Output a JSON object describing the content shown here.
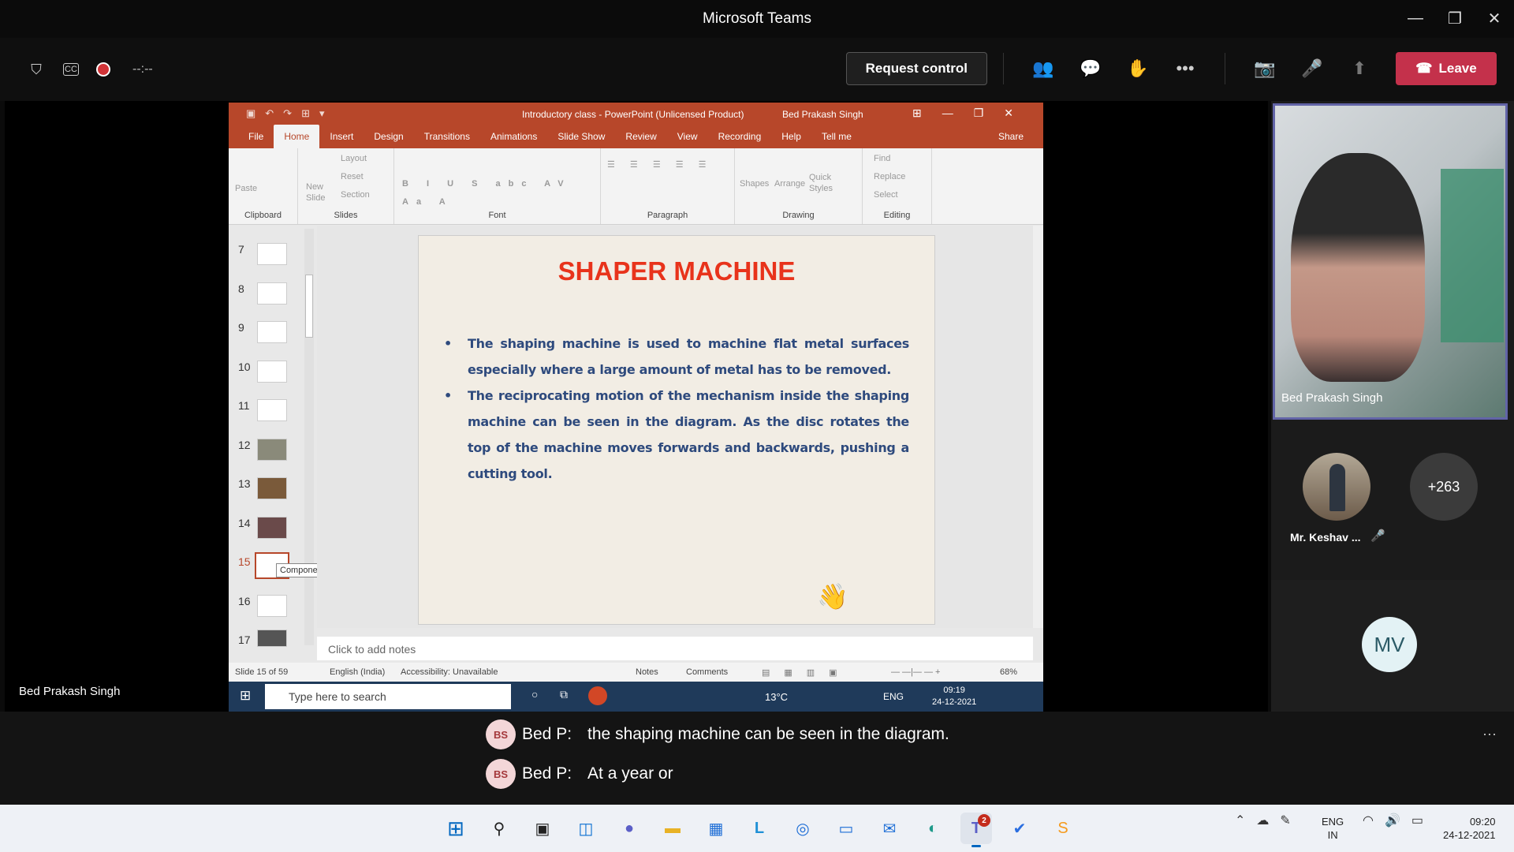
{
  "window": {
    "title": "Microsoft Teams"
  },
  "callbar": {
    "timer": "--:--",
    "request_control": "Request control",
    "leave": "Leave"
  },
  "stage": {
    "presenter_name": "Bed Prakash Singh"
  },
  "ppt": {
    "doc_title": "Introductory class - PowerPoint (Unlicensed Product)",
    "user": "Bed Prakash Singh",
    "tabs": [
      "File",
      "Home",
      "Insert",
      "Design",
      "Transitions",
      "Animations",
      "Slide Show",
      "Review",
      "View",
      "Recording",
      "Help",
      "Tell me",
      "Share"
    ],
    "groups": {
      "clipboard": "Clipboard",
      "slides": "Slides",
      "font": "Font",
      "paragraph": "Paragraph",
      "drawing": "Drawing",
      "editing": "Editing"
    },
    "ribbon_items": {
      "paste": "Paste",
      "new_slide": "New Slide",
      "layout": "Layout",
      "reset": "Reset",
      "section": "Section",
      "shapes": "Shapes",
      "arrange": "Arrange",
      "quick_styles": "Quick Styles",
      "find": "Find",
      "replace": "Replace",
      "select": "Select"
    },
    "thumb_numbers": [
      "7",
      "8",
      "9",
      "10",
      "11",
      "12",
      "13",
      "14",
      "15",
      "16",
      "17"
    ],
    "current_slide": "15",
    "tooltip": "Component Description of  Ce...",
    "slide": {
      "title": "SHAPER MACHINE",
      "bullets": [
        "The shaping machine is used to machine flat metal surfaces especially where a large amount of metal has to be removed.",
        "The reciprocating motion of the mechanism inside the shaping machine can be seen in the diagram. As the disc rotates the top of the machine moves forwards and backwards, pushing a cutting tool."
      ]
    },
    "notes_placeholder": "Click to add notes",
    "status": {
      "slide": "Slide 15 of 59",
      "lang": "English (India)",
      "access": "Accessibility: Unavailable",
      "notes": "Notes",
      "comments": "Comments",
      "zoom": "68%"
    },
    "taskbar": {
      "search": "Type here to search",
      "temp": "13°C",
      "lang": "ENG",
      "time": "09:19",
      "date": "24-12-2021"
    }
  },
  "panel": {
    "self_name": "Bed Prakash Singh",
    "p1_name": "Mr. Keshav ...",
    "more": "+263",
    "mv": "MV"
  },
  "captions": [
    {
      "initials": "BS",
      "speaker": "Bed P:",
      "text": "the shaping machine can be seen in the diagram."
    },
    {
      "initials": "BS",
      "speaker": "Bed P:",
      "text": "At a year or"
    }
  ],
  "taskbar": {
    "teams_badge": "2",
    "lang1": "ENG",
    "lang2": "IN",
    "time": "09:20",
    "date": "24-12-2021"
  },
  "colors": {
    "ppt_accent": "#b7472a",
    "leave": "#c4314b",
    "teams_purple": "#6264a7"
  }
}
